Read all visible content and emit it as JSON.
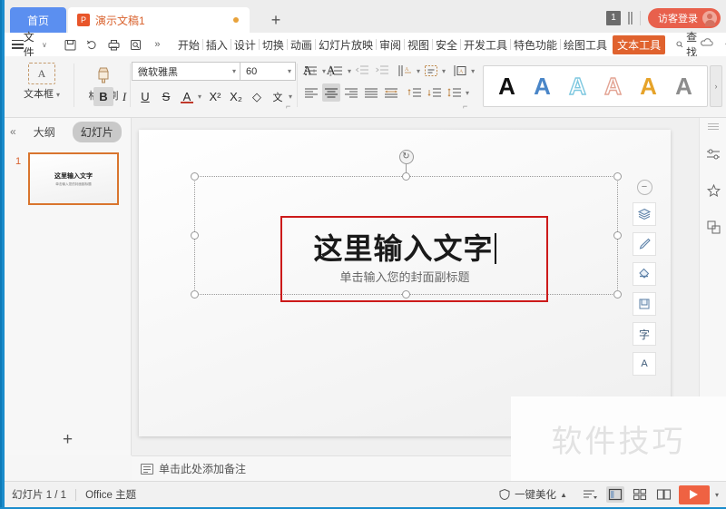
{
  "titlebar": {
    "home_tab": "首页",
    "doc_tab": {
      "label": "演示文稿1",
      "icon": "P"
    },
    "new_tab_icon": "+",
    "badge_count": "1",
    "guest_login": "访客登录"
  },
  "ribbonbar": {
    "file_menu": "文件",
    "quick_access": [
      "save-icon",
      "rotate-icon",
      "print-icon",
      "print-preview-icon",
      "more-chevron-icon"
    ],
    "tabs": [
      {
        "label": "开始",
        "selected": false
      },
      {
        "label": "插入",
        "selected": false
      },
      {
        "label": "设计",
        "selected": false
      },
      {
        "label": "切换",
        "selected": false
      },
      {
        "label": "动画",
        "selected": false
      },
      {
        "label": "幻灯片放映",
        "selected": false
      },
      {
        "label": "审阅",
        "selected": false
      },
      {
        "label": "视图",
        "selected": false
      },
      {
        "label": "安全",
        "selected": false
      },
      {
        "label": "开发工具",
        "selected": false
      },
      {
        "label": "特色功能",
        "selected": false
      },
      {
        "label": "绘图工具",
        "selected": false
      },
      {
        "label": "文本工具",
        "selected": true
      }
    ],
    "find_label": "查找",
    "right_icons": [
      "cloud-sync-icon",
      "share-user-icon",
      "export-icon",
      "more-vert-icon",
      "collapse-ribbon-icon"
    ]
  },
  "ribbon": {
    "textbox_group": {
      "label": "文本框",
      "icon_glyph": "A"
    },
    "format_painter": {
      "label": "格式刷"
    },
    "font": {
      "name_value": "微软雅黑",
      "size_value": "60",
      "increase_label": "A",
      "decrease_label": "A"
    },
    "style_buttons": [
      {
        "name": "bold",
        "label": "B",
        "active": true
      },
      {
        "name": "italic",
        "label": "I",
        "active": false
      },
      {
        "name": "underline",
        "label": "U",
        "active": false
      },
      {
        "name": "strikethrough",
        "label": "S",
        "active": false
      },
      {
        "name": "font-color",
        "label": "A",
        "active": false
      },
      {
        "name": "superscript",
        "label": "X²",
        "active": false
      },
      {
        "name": "subscript",
        "label": "X₂",
        "active": false
      },
      {
        "name": "clear-format",
        "label": "◇",
        "active": false
      },
      {
        "name": "phonetic",
        "label": "文",
        "active": false
      }
    ],
    "wordart_styles": [
      {
        "name": "wordart-black",
        "glyph": "A",
        "color": "#111111",
        "outline": false
      },
      {
        "name": "wordart-blue",
        "glyph": "A",
        "color": "#4a86c8",
        "outline": false
      },
      {
        "name": "wordart-lightblue-outline",
        "glyph": "A",
        "color": "#7ec8e0",
        "outline": true
      },
      {
        "name": "wordart-salmon-outline",
        "glyph": "A",
        "color": "#e3a494",
        "outline": true
      },
      {
        "name": "wordart-orange",
        "glyph": "A",
        "color": "#e6a32a",
        "outline": false
      },
      {
        "name": "wordart-gray",
        "glyph": "A",
        "color": "#8d8d8d",
        "outline": false
      }
    ]
  },
  "left_pane": {
    "collapse_icon": "«",
    "tabs": [
      {
        "label": "大纲",
        "active": false
      },
      {
        "label": "幻灯片",
        "active": true
      }
    ],
    "slides": [
      {
        "number": "1",
        "title": "这里输入文字",
        "subtitle": "单击输入您的封面副标题"
      }
    ],
    "add_slide_icon": "+"
  },
  "slide": {
    "title": "这里输入文字",
    "subtitle": "单击输入您的封面副标题",
    "annotation_color": "#cc1a1a",
    "rotate_handle_icon": "rotate-icon"
  },
  "float_toolbar": {
    "minimize_icon": "−",
    "buttons": [
      {
        "name": "layers-icon",
        "glyph": "◈"
      },
      {
        "name": "brush-icon",
        "glyph": "✎"
      },
      {
        "name": "fill-icon",
        "glyph": "◇"
      },
      {
        "name": "frame-icon",
        "glyph": "▢"
      },
      {
        "name": "text-style-icon",
        "glyph": "字"
      },
      {
        "name": "replace-text-icon",
        "glyph": "A"
      }
    ]
  },
  "right_bar": {
    "icons": [
      {
        "name": "settings-sliders-icon",
        "glyph": "⚌"
      },
      {
        "name": "magic-star-icon",
        "glyph": "✧"
      },
      {
        "name": "duplicate-layers-icon",
        "glyph": "⧉"
      }
    ]
  },
  "notes": {
    "placeholder": "单击此处添加备注"
  },
  "statusbar": {
    "slide_count": "幻灯片 1 / 1",
    "theme": "Office 主题",
    "beautify": "一键美化",
    "beautify_caret": "▲",
    "view_buttons": [
      {
        "name": "layout-list-icon",
        "glyph": "≡",
        "active": false
      },
      {
        "name": "normal-view-icon",
        "glyph": "▤",
        "active": true
      },
      {
        "name": "slide-sorter-icon",
        "glyph": "⊞",
        "active": false
      },
      {
        "name": "reading-view-icon",
        "glyph": "▭",
        "active": false
      }
    ],
    "play_caret": "▾"
  },
  "watermark": {
    "text": "软件技巧"
  }
}
